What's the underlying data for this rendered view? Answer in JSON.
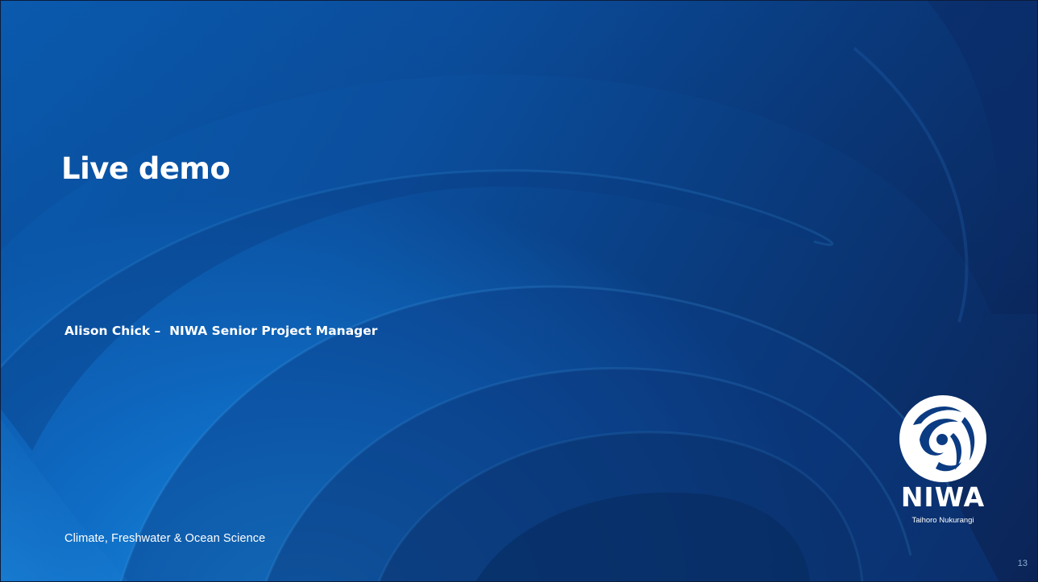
{
  "slide": {
    "title": "Live demo",
    "presenter": "Alison Chick –  NIWA Senior Project Manager",
    "tagline": "Climate, Freshwater & Ocean Science",
    "slide_number": "13"
  },
  "logo": {
    "icon": "niwa-emblem-icon",
    "wordmark": "NIWA",
    "subtitle": "Taihoro Nukurangi"
  },
  "colors": {
    "background_dark": "#0b2457",
    "background_mid": "#0b4f9e",
    "background_light": "#1a8fe0",
    "text": "#ffffff"
  }
}
